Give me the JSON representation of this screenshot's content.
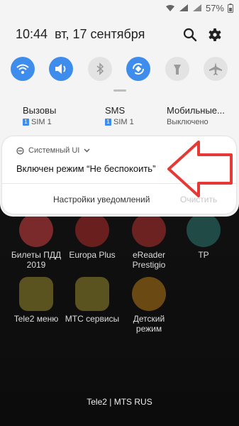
{
  "status_bar": {
    "battery": "57%"
  },
  "header": {
    "time": "10:44",
    "date": "вт, 17 сентября"
  },
  "quick_settings": [
    {
      "name": "wifi",
      "on": true
    },
    {
      "name": "sound",
      "on": true
    },
    {
      "name": "bluetooth",
      "on": false
    },
    {
      "name": "auto-rotate",
      "on": true
    },
    {
      "name": "flashlight",
      "on": false
    },
    {
      "name": "airplane",
      "on": false
    }
  ],
  "sims": [
    {
      "title": "Вызовы",
      "sub": "SIM 1",
      "badge": "1"
    },
    {
      "title": "SMS",
      "sub": "SIM 1",
      "badge": "1"
    },
    {
      "title": "Мобильные...",
      "sub": "Выключено"
    }
  ],
  "notification": {
    "app": "Системный UI",
    "title": "Включен режим “Не беспокоить”",
    "settings_button": "Настройки уведомлений",
    "clear_button": "Очистить"
  },
  "home_apps": [
    {
      "label": "Билеты ПДД 2019",
      "color": "#e53935"
    },
    {
      "label": "Europa Plus",
      "color": "#c62828"
    },
    {
      "label": "eReader Prestigio",
      "color": "#d32f2f"
    },
    {
      "label": "TP",
      "color": "#26a69a"
    },
    {
      "label": "Tele2 меню",
      "color": "#fdd835"
    },
    {
      "label": "МТС сервисы",
      "color": "#fdd835"
    },
    {
      "label": "Детский режим",
      "color": "#ffb300"
    }
  ],
  "dock": {
    "carrier": "Tele2 | MTS RUS"
  },
  "colors": {
    "accent": "#3e8ded",
    "arrow": "#e53935"
  }
}
